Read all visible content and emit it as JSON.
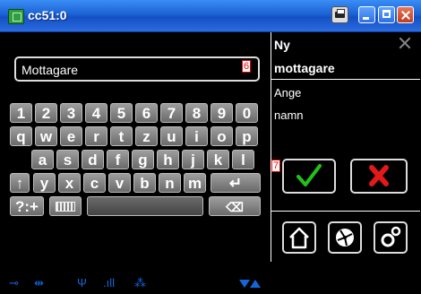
{
  "window": {
    "title": "cc51:0"
  },
  "input": {
    "value": "Mottagare",
    "badge": "6"
  },
  "keyboard": {
    "row1": [
      "1",
      "2",
      "3",
      "4",
      "5",
      "6",
      "7",
      "8",
      "9",
      "0"
    ],
    "row2": [
      "q",
      "w",
      "e",
      "r",
      "t",
      "z",
      "u",
      "i",
      "o",
      "p"
    ],
    "row3": [
      "a",
      "s",
      "d",
      "f",
      "g",
      "h",
      "j",
      "k",
      "l"
    ],
    "row4": [
      "y",
      "x",
      "c",
      "v",
      "b",
      "n",
      "m"
    ],
    "symbols_label": "?:+"
  },
  "panel": {
    "title_line1": "Ny",
    "title_line2": "mottagare",
    "instruction_line1": "Ange",
    "instruction_line2": "namn",
    "ok_badge": "7"
  },
  "colors": {
    "titlebar": "#1c62d6",
    "ok": "#22c01a",
    "cancel": "#e31818",
    "status": "#1565d8"
  }
}
